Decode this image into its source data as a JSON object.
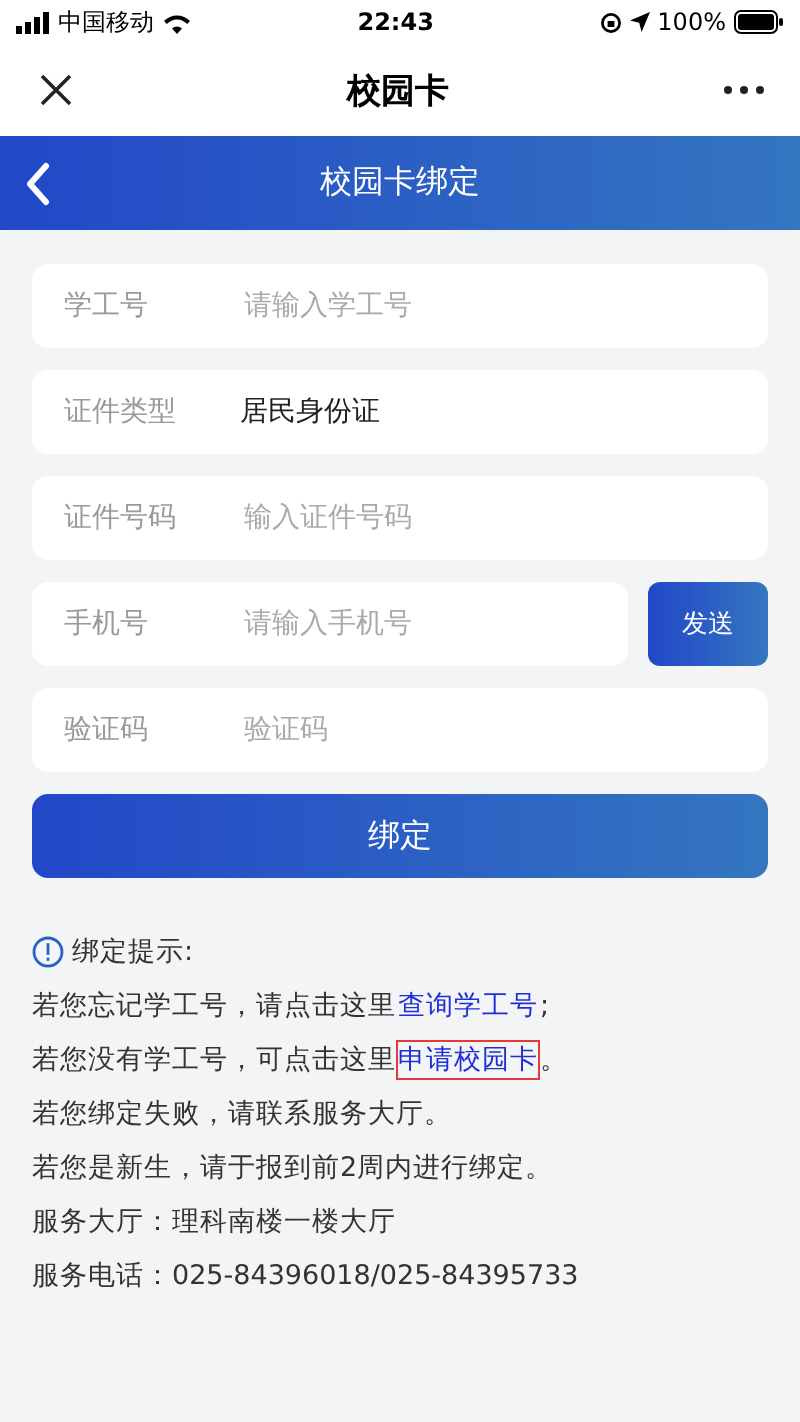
{
  "status_bar": {
    "carrier": "中国移动",
    "time": "22:43",
    "battery": "100%"
  },
  "nav_bar": {
    "title": "校园卡"
  },
  "header": {
    "title": "校园卡绑定"
  },
  "form": {
    "fields": [
      {
        "kind": "input",
        "label": "学工号",
        "placeholder": "请输入学工号"
      },
      {
        "kind": "select",
        "label": "证件类型",
        "value": "居民身份证"
      },
      {
        "kind": "input",
        "label": "证件号码",
        "placeholder": "输入证件号码"
      },
      {
        "kind": "send",
        "label": "手机号",
        "placeholder": "请输入手机号",
        "button": "发送"
      },
      {
        "kind": "input",
        "label": "验证码",
        "placeholder": "验证码"
      }
    ],
    "submit": "绑定"
  },
  "tips": {
    "title": "绑定提示:",
    "lines": [
      {
        "text": "若您忘记学工号，请点击这里",
        "link": "查询学工号",
        "after": ";",
        "highlighted": false
      },
      {
        "text": "若您没有学工号，可点击这里",
        "link": "申请校园卡",
        "after": "。",
        "highlighted": true
      },
      {
        "text": "若您绑定失败，请联系服务大厅。"
      },
      {
        "text": "若您是新生，请于报到前2周内进行绑定。"
      },
      {
        "text": "服务大厅：理科南楼一楼大厅"
      },
      {
        "text": "服务电话：025-84396018/025-84395733"
      }
    ]
  }
}
